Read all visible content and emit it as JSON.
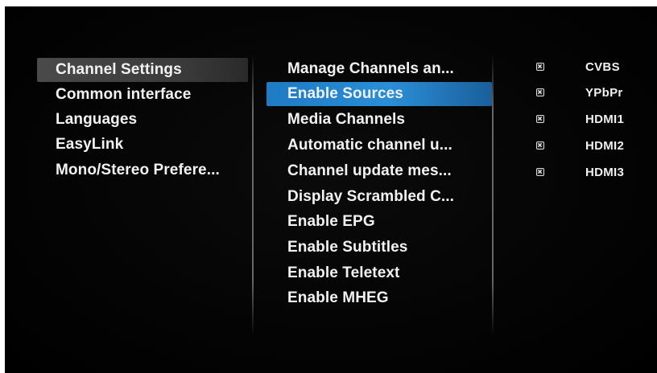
{
  "main_menu": {
    "items": [
      {
        "label": "Channel Settings"
      },
      {
        "label": "Common interface"
      },
      {
        "label": "Languages"
      },
      {
        "label": "EasyLink"
      },
      {
        "label": "Mono/Stereo Prefere..."
      }
    ]
  },
  "sub_menu": {
    "items": [
      {
        "label": "Manage Channels an..."
      },
      {
        "label": "Enable Sources"
      },
      {
        "label": "Media Channels"
      },
      {
        "label": "Automatic channel u..."
      },
      {
        "label": "Channel update mes..."
      },
      {
        "label": "Display Scrambled C..."
      },
      {
        "label": "Enable EPG"
      },
      {
        "label": "Enable Subtitles"
      },
      {
        "label": "Enable Teletext"
      },
      {
        "label": "Enable MHEG"
      }
    ]
  },
  "sources": {
    "items": [
      {
        "label": "CVBS",
        "checked": true
      },
      {
        "label": "YPbPr",
        "checked": true
      },
      {
        "label": "HDMI1",
        "checked": true
      },
      {
        "label": "HDMI2",
        "checked": true
      },
      {
        "label": "HDMI3",
        "checked": true
      }
    ]
  },
  "colors": {
    "highlight_blue": "#2a8ed6",
    "highlight_grey": "#444444",
    "text": "#f2f2f2",
    "background": "#050505"
  }
}
